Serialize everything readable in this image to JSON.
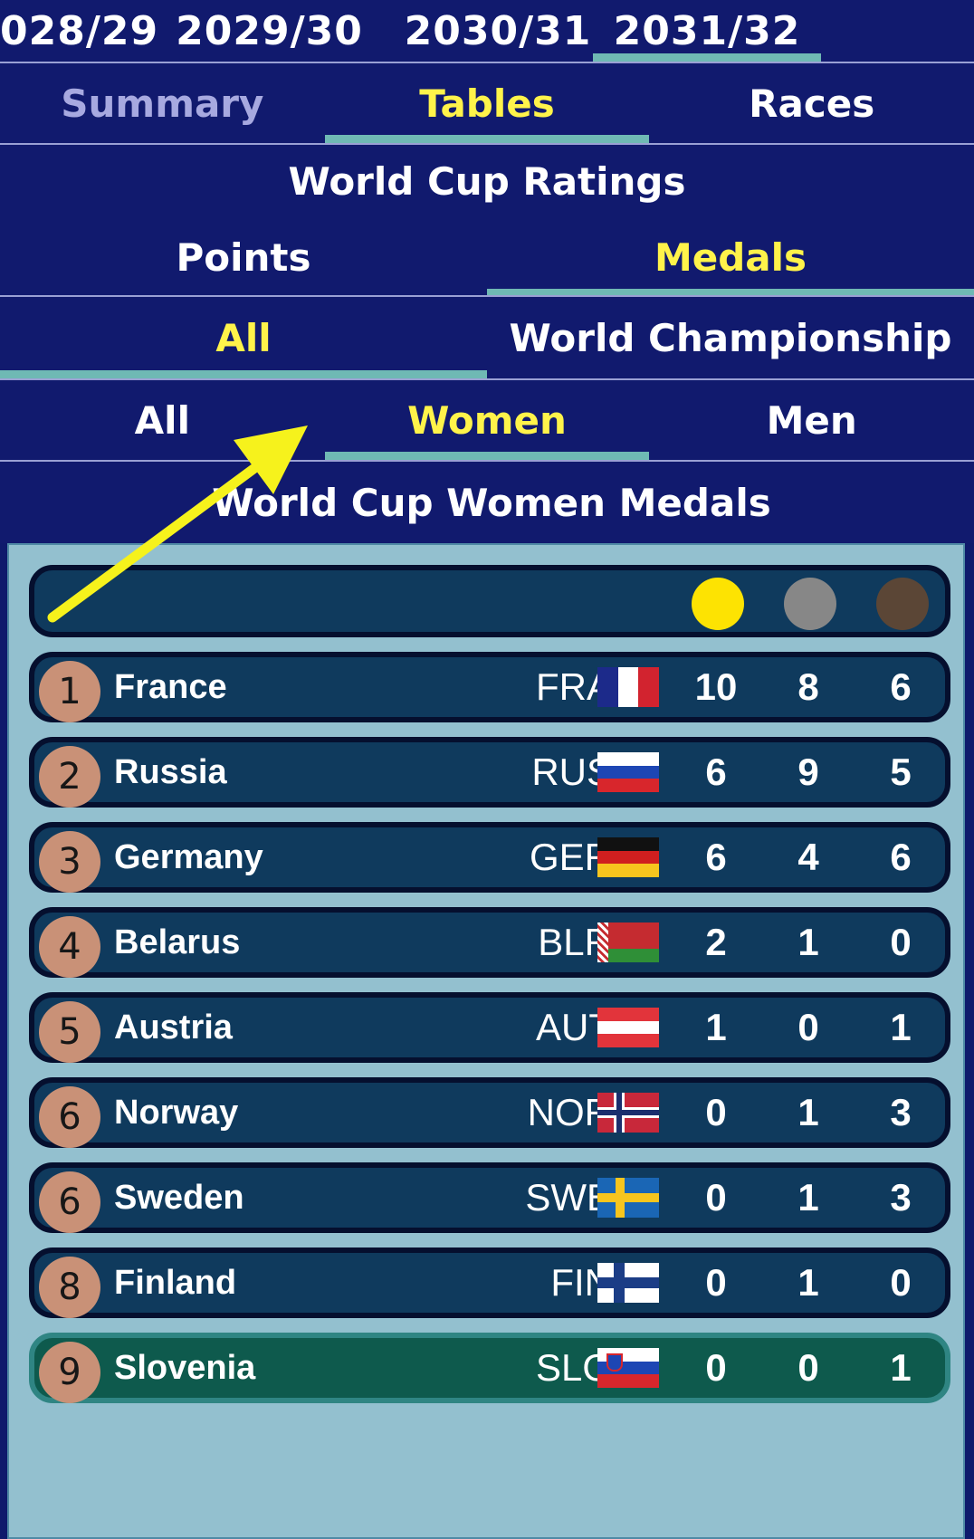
{
  "seasons": [
    "028/29",
    "2029/30",
    "2030/31",
    "2031/32"
  ],
  "main_tabs": [
    "Summary",
    "Tables",
    "Races"
  ],
  "ratings_title": "World Cup Ratings",
  "rating_type_tabs": [
    "Points",
    "Medals"
  ],
  "competition_tabs": [
    "All",
    "World Championship"
  ],
  "gender_tabs": [
    "All",
    "Women",
    "Men"
  ],
  "table_title": "World Cup Women Medals",
  "medal_header": {
    "gold": "#fde302",
    "silver": "#878787",
    "bronze": "#5b4636"
  },
  "rows": [
    {
      "rank": "1",
      "country": "France",
      "code": "FRA",
      "gold": "10",
      "silver": "8",
      "bronze": "6",
      "flag": "france"
    },
    {
      "rank": "2",
      "country": "Russia",
      "code": "RUS",
      "gold": "6",
      "silver": "9",
      "bronze": "5",
      "flag": "russia"
    },
    {
      "rank": "3",
      "country": "Germany",
      "code": "GER",
      "gold": "6",
      "silver": "4",
      "bronze": "6",
      "flag": "germany"
    },
    {
      "rank": "4",
      "country": "Belarus",
      "code": "BLR",
      "gold": "2",
      "silver": "1",
      "bronze": "0",
      "flag": "belarus"
    },
    {
      "rank": "5",
      "country": "Austria",
      "code": "AUT",
      "gold": "1",
      "silver": "0",
      "bronze": "1",
      "flag": "austria"
    },
    {
      "rank": "6",
      "country": "Norway",
      "code": "NOR",
      "gold": "0",
      "silver": "1",
      "bronze": "3",
      "flag": "norway"
    },
    {
      "rank": "6",
      "country": "Sweden",
      "code": "SWE",
      "gold": "0",
      "silver": "1",
      "bronze": "3",
      "flag": "sweden"
    },
    {
      "rank": "8",
      "country": "Finland",
      "code": "FIN",
      "gold": "0",
      "silver": "1",
      "bronze": "0",
      "flag": "finland"
    },
    {
      "rank": "9",
      "country": "Slovenia",
      "code": "SLO",
      "gold": "0",
      "silver": "0",
      "bronze": "1",
      "flag": "slovenia"
    }
  ],
  "colors": {
    "accent_yellow": "#fff34a",
    "nav_bg": "#111a6e",
    "row_bg": "#0f3a5d",
    "highlight_row_bg": "#0e5a4d",
    "rank_badge": "#c99177",
    "tab_underline": "#6fb9b4"
  }
}
